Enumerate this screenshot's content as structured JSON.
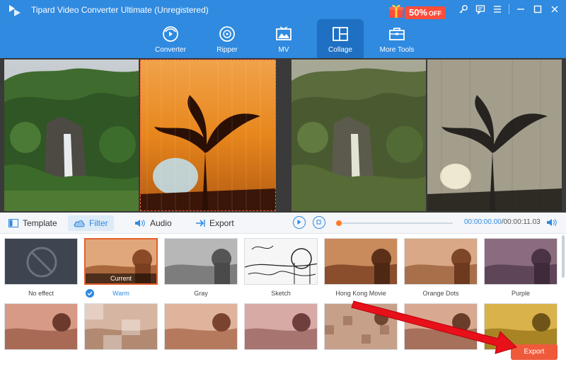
{
  "app": {
    "title": "Tipard Video Converter Ultimate (Unregistered)"
  },
  "promo": {
    "percent": "50%",
    "suffix": "OFF"
  },
  "window_icons": [
    "key-icon",
    "feedback-icon",
    "menu-icon",
    "minimize-icon",
    "maximize-icon",
    "close-icon"
  ],
  "nav": {
    "tabs": [
      {
        "label": "Converter",
        "icon": "converter-icon"
      },
      {
        "label": "Ripper",
        "icon": "ripper-icon"
      },
      {
        "label": "MV",
        "icon": "mv-icon"
      },
      {
        "label": "Collage",
        "icon": "collage-icon"
      },
      {
        "label": "More Tools",
        "icon": "toolbox-icon"
      }
    ],
    "active": "Collage"
  },
  "tooltabs": {
    "template": "Template",
    "filter": "Filter",
    "audio": "Audio",
    "export": "Export",
    "active": "Filter"
  },
  "player": {
    "current": "00:00:00.00",
    "separator": "/",
    "total": "00:00:11.03",
    "progress": 0
  },
  "filters": {
    "current_tag": "Current",
    "row1": [
      {
        "label": "No effect"
      },
      {
        "label": "Warm",
        "selected": true
      },
      {
        "label": "Gray"
      },
      {
        "label": "Sketch"
      },
      {
        "label": "Hong Kong Movie"
      },
      {
        "label": "Orange Dots"
      },
      {
        "label": "Purple"
      }
    ],
    "row2_count": 7
  },
  "export_button": {
    "label": "Export"
  },
  "colors": {
    "topbar": "#2f8ae0",
    "active_tab": "#1f70c2",
    "accent": "#2f8ae0",
    "export": "#ef5a3b",
    "arrow": "#e8101a"
  }
}
